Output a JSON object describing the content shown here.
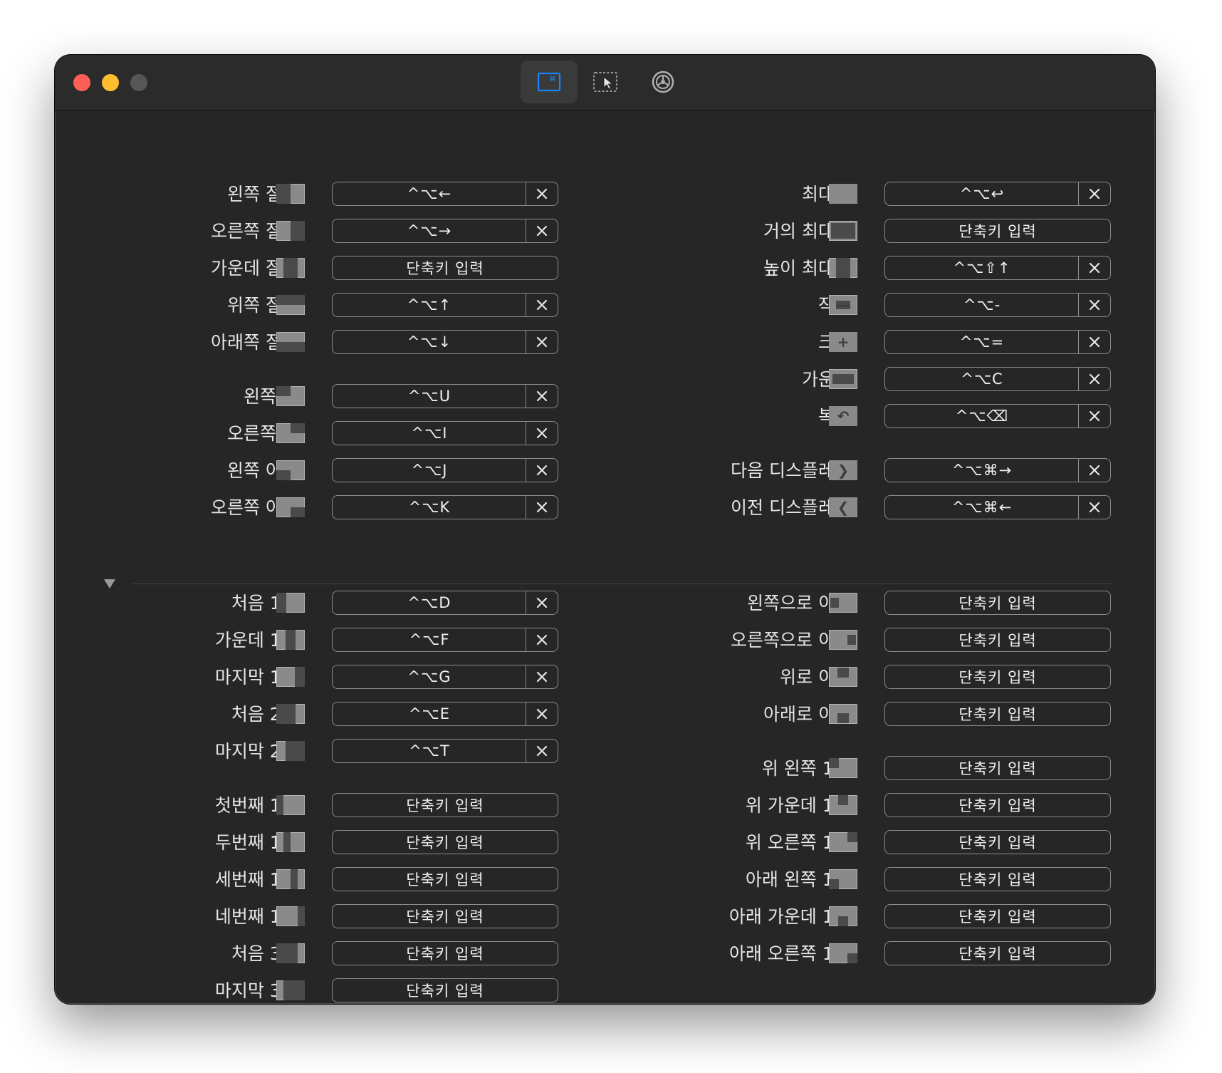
{
  "toolbar": {
    "tabs": [
      {
        "name": "shortcuts",
        "icon": "keyboard-shortcuts-icon",
        "active": true
      },
      {
        "name": "snap-areas",
        "icon": "snap-cursor-icon",
        "active": false
      },
      {
        "name": "general",
        "icon": "gear-icon",
        "active": false
      }
    ]
  },
  "colors": {
    "window_bg": "#262626",
    "accent": "#1a84ff"
  },
  "placeholder": "단축키 입력",
  "left_rows": [
    {
      "label": "왼쪽 절반",
      "shortcut": "^⌥←"
    },
    {
      "label": "오른쪽 절반",
      "shortcut": "^⌥→"
    },
    {
      "label": "가운데 절반",
      "shortcut": ""
    },
    {
      "label": "위쪽 절반",
      "shortcut": "^⌥↑"
    },
    {
      "label": "아래쪽 절반",
      "shortcut": "^⌥↓"
    },
    {
      "label": "왼쪽 위",
      "shortcut": "^⌥U"
    },
    {
      "label": "오른쪽 위",
      "shortcut": "^⌥I"
    },
    {
      "label": "왼쪽 아래",
      "shortcut": "^⌥J"
    },
    {
      "label": "오른쪽 아래",
      "shortcut": "^⌥K"
    },
    {
      "label": "처음 1/3",
      "shortcut": "^⌥D"
    },
    {
      "label": "가운데 1/3",
      "shortcut": "^⌥F"
    },
    {
      "label": "마지막 1/3",
      "shortcut": "^⌥G"
    },
    {
      "label": "처음 2/3",
      "shortcut": "^⌥E"
    },
    {
      "label": "마지막 2/3",
      "shortcut": "^⌥T"
    },
    {
      "label": "첫번째 1/4",
      "shortcut": ""
    },
    {
      "label": "두번째 1/4",
      "shortcut": ""
    },
    {
      "label": "세번째 1/4",
      "shortcut": ""
    },
    {
      "label": "네번째 1/4",
      "shortcut": ""
    },
    {
      "label": "처음 3/4",
      "shortcut": ""
    },
    {
      "label": "마지막 3/4",
      "shortcut": ""
    }
  ],
  "right_rows": [
    {
      "label": "최대화",
      "shortcut": "^⌥↩"
    },
    {
      "label": "거의 최대화",
      "shortcut": ""
    },
    {
      "label": "높이 최대화",
      "shortcut": "^⌥⇧↑"
    },
    {
      "label": "작게",
      "shortcut": "^⌥-"
    },
    {
      "label": "크게",
      "shortcut": "^⌥="
    },
    {
      "label": "가운데",
      "shortcut": "^⌥C"
    },
    {
      "label": "복원",
      "shortcut": "^⌥⌫"
    },
    {
      "label": "다음 디스플레이",
      "shortcut": "^⌥⌘→"
    },
    {
      "label": "이전 디스플레이",
      "shortcut": "^⌥⌘←"
    },
    {
      "label": "왼쪽으로 이동",
      "shortcut": ""
    },
    {
      "label": "오른쪽으로 이동",
      "shortcut": ""
    },
    {
      "label": "위로 이동",
      "shortcut": ""
    },
    {
      "label": "아래로 이동",
      "shortcut": ""
    },
    {
      "label": "위 왼쪽 1/6",
      "shortcut": ""
    },
    {
      "label": "위 가운데 1/6",
      "shortcut": ""
    },
    {
      "label": "위 오른쪽 1/6",
      "shortcut": ""
    },
    {
      "label": "아래 왼쪽 1/6",
      "shortcut": ""
    },
    {
      "label": "아래 가운데 1/6",
      "shortcut": ""
    },
    {
      "label": "아래 오른쪽 1/6",
      "shortcut": ""
    }
  ]
}
